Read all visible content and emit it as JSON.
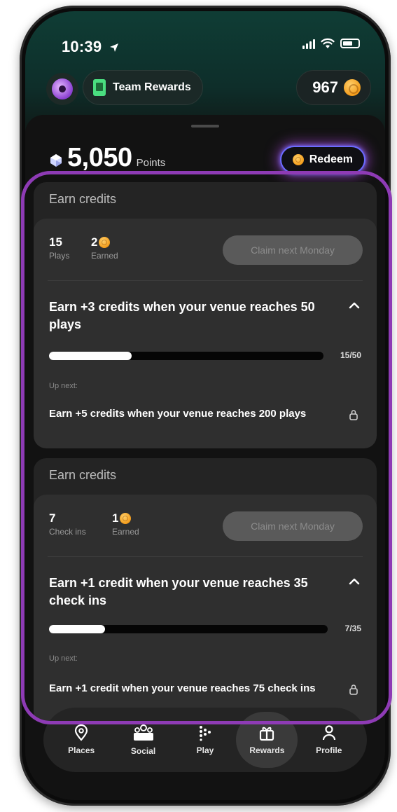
{
  "status_bar": {
    "time": "10:39"
  },
  "header": {
    "team_label": "Team Rewards",
    "coins": "967"
  },
  "points": {
    "value": "5,050",
    "label": "Points",
    "redeem_label": "Redeem"
  },
  "cards": [
    {
      "title": "Earn credits",
      "stat1": {
        "value": "15",
        "label": "Plays"
      },
      "stat2": {
        "value": "2",
        "label": "Earned"
      },
      "claim_label": "Claim next Monday",
      "goal": "Earn +3 credits when your venue reaches 50 plays",
      "progress": {
        "current": 15,
        "total": 50,
        "text": "15/50"
      },
      "up_next_label": "Up next:",
      "next_goal": "Earn +5 credits when your venue reaches 200 plays"
    },
    {
      "title": "Earn credits",
      "stat1": {
        "value": "7",
        "label": "Check ins"
      },
      "stat2": {
        "value": "1",
        "label": "Earned"
      },
      "claim_label": "Claim next Monday",
      "goal": "Earn +1 credit when your venue reaches 35 check ins",
      "progress": {
        "current": 7,
        "total": 35,
        "text": "7/35"
      },
      "up_next_label": "Up next:",
      "next_goal": "Earn +1 credit when your venue reaches 75 check ins"
    }
  ],
  "nav": {
    "tabs": [
      {
        "id": "places",
        "label": "Places",
        "icon": "location-pin-icon"
      },
      {
        "id": "social",
        "label": "Social",
        "icon": "social-beta-icon",
        "badge": "BETA"
      },
      {
        "id": "play",
        "label": "Play",
        "icon": "play-dots-icon"
      },
      {
        "id": "rewards",
        "label": "Rewards",
        "icon": "gift-icon",
        "active": true
      },
      {
        "id": "profile",
        "label": "Profile",
        "icon": "person-icon"
      }
    ]
  },
  "colors": {
    "highlight": "#8e3bb5",
    "coin": "#f39c1b",
    "redeem_glow": "#c850ff",
    "background": "#121212"
  }
}
